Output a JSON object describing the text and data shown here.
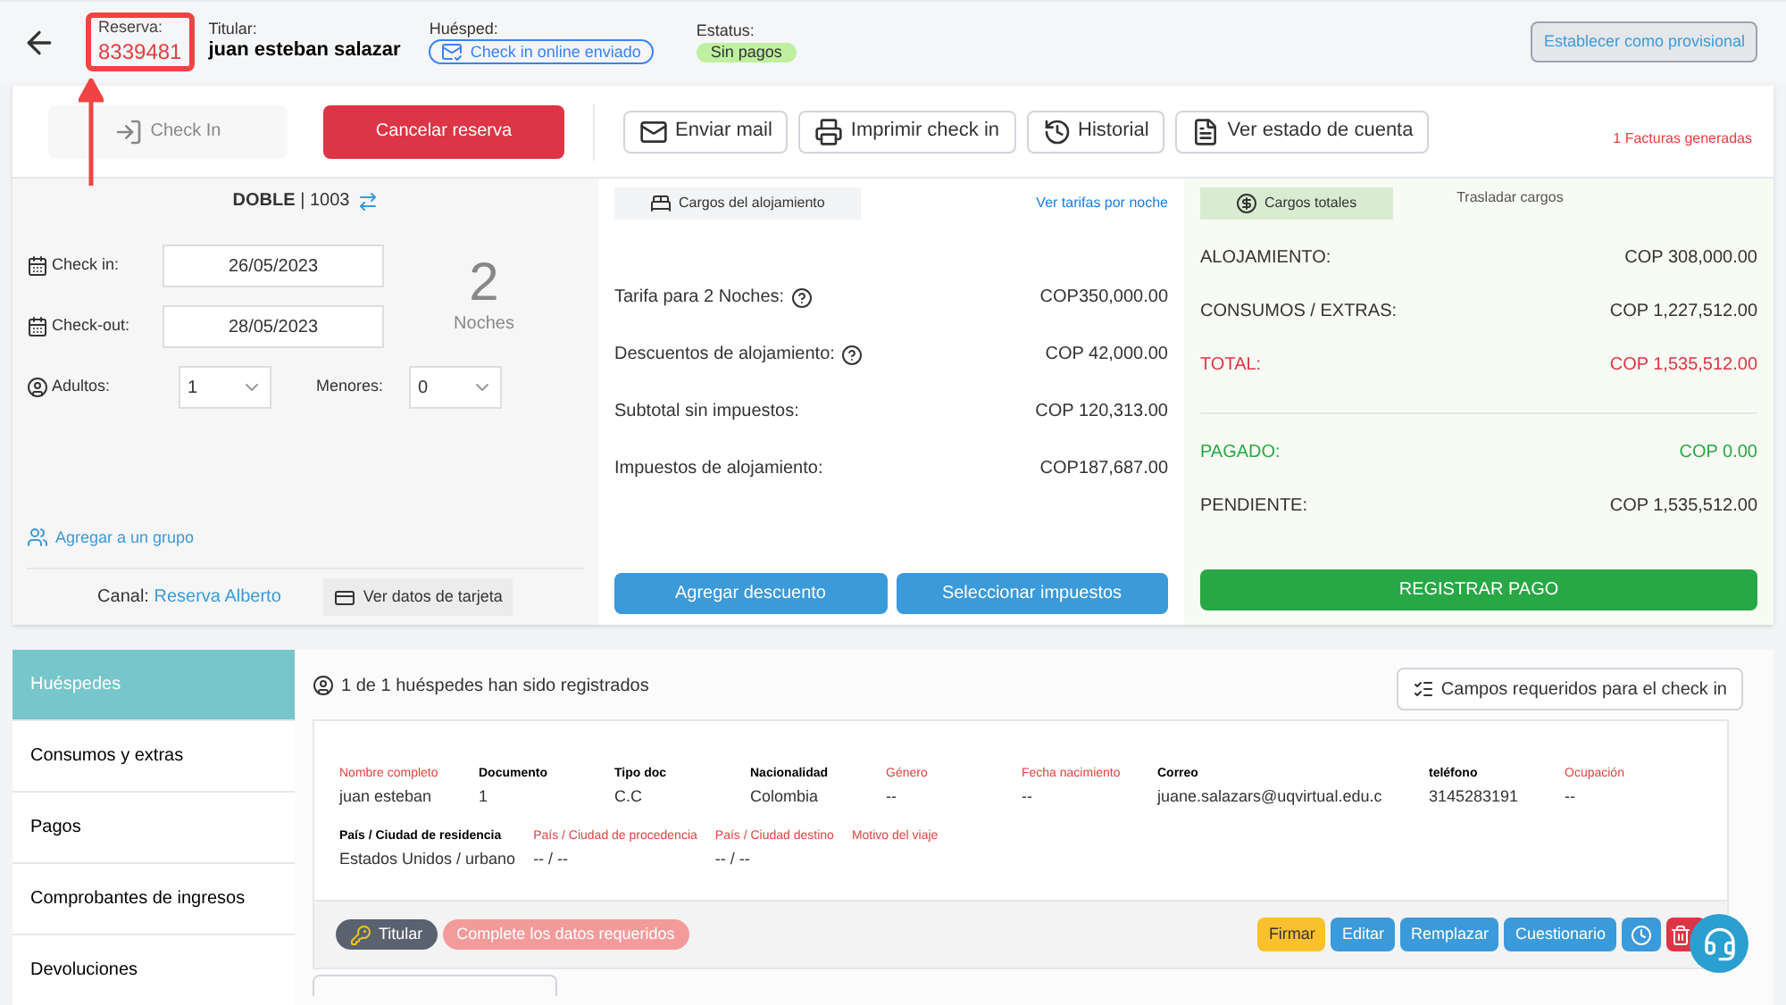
{
  "header": {
    "reservation": {
      "label": "Reserva:",
      "number": "8339481"
    },
    "holder": {
      "label": "Titular:",
      "name": "juan esteban salazar"
    },
    "guest": {
      "label": "Huésped:",
      "badge": "Check in online enviado"
    },
    "status": {
      "label": "Estatus:",
      "badge": "Sin pagos"
    },
    "provisional_button": "Establecer como provisional"
  },
  "actions": {
    "check_in": {
      "label": "Check In",
      "disabled": true
    },
    "cancel": "Cancelar reserva",
    "buttons": [
      {
        "label": "Enviar mail",
        "kind": "mail"
      },
      {
        "label": "Imprimir check in",
        "kind": "print"
      },
      {
        "label": "Historial",
        "kind": "history"
      },
      {
        "label": "Ver estado de cuenta",
        "kind": "statement"
      }
    ],
    "invoices": "1 Facturas generadas"
  },
  "room": {
    "type": "DOBLE",
    "separator": "|",
    "number": "1003",
    "check_in": {
      "label": "Check in:",
      "value": "26/05/2023"
    },
    "check_out": {
      "label": "Check-out:",
      "value": "28/05/2023"
    },
    "nights": {
      "count": "2",
      "label": "Noches"
    },
    "adults": {
      "label": "Adultos:",
      "value": "1"
    },
    "minors": {
      "label": "Menores:",
      "value": "0"
    },
    "group_link": "Agregar a un grupo",
    "channel": {
      "label": "Canal:",
      "value": "Reserva Alberto"
    },
    "card_button": "Ver datos de tarjeta"
  },
  "charges": {
    "tab": "Cargos del alojamiento",
    "rates_link": "Ver tarifas por noche",
    "rows": [
      {
        "label": "Tarifa para 2 Noches:",
        "help": true,
        "value": "COP350,000.00"
      },
      {
        "label": "Descuentos de alojamiento:",
        "help": true,
        "value": "COP 42,000.00"
      },
      {
        "label": "Subtotal sin impuestos:",
        "help": false,
        "value": "COP 120,313.00"
      },
      {
        "label": "Impuestos de alojamiento:",
        "help": false,
        "value": "COP187,687.00"
      }
    ],
    "buttons": [
      "Agregar descuento",
      "Seleccionar impuestos"
    ]
  },
  "totals": {
    "tabs": [
      {
        "label": "Cargos totales",
        "selected": true
      },
      {
        "label": "Trasladar cargos",
        "selected": false
      }
    ],
    "rows": [
      {
        "label": "ALOJAMIENTO:",
        "value": "COP 308,000.00",
        "kind": "normal"
      },
      {
        "label": "CONSUMOS / EXTRAS:",
        "value": "COP 1,227,512.00",
        "kind": "normal"
      },
      {
        "label": "TOTAL:",
        "value": "COP 1,535,512.00",
        "kind": "total"
      },
      {
        "label": "PAGADO:",
        "value": "COP 0.00",
        "kind": "paid"
      },
      {
        "label": "PENDIENTE:",
        "value": "COP 1,535,512.00",
        "kind": "normal"
      }
    ],
    "pay_button": "REGISTRAR PAGO"
  },
  "sidebar": [
    {
      "label": "Huéspedes",
      "selected": true
    },
    {
      "label": "Consumos y extras",
      "selected": false
    },
    {
      "label": "Pagos",
      "selected": false
    },
    {
      "label": "Comprobantes de ingresos",
      "selected": false
    },
    {
      "label": "Devoluciones",
      "selected": false
    }
  ],
  "guests": {
    "summary": "1 de 1 huéspedes han sido registrados",
    "required_button": "Campos requeridos para el check in",
    "fields_row1": [
      {
        "label": "Nombre completo",
        "value": "juan esteban",
        "required": true
      },
      {
        "label": "Documento",
        "value": "1",
        "required": false
      },
      {
        "label": "Tipo doc",
        "value": "C.C",
        "required": false
      },
      {
        "label": "Nacionalidad",
        "value": "Colombia",
        "required": false
      },
      {
        "label": "Género",
        "value": "--",
        "required": true
      },
      {
        "label": "Fecha nacimiento",
        "value": "--",
        "required": true
      },
      {
        "label": "Correo",
        "value": "juane.salazars@uqvirtual.edu.c",
        "required": false
      },
      {
        "label": "teléfono",
        "value": "3145283191",
        "required": false
      },
      {
        "label": "Ocupación",
        "value": "--",
        "required": true
      }
    ],
    "fields_row2": [
      {
        "label": "País / Ciudad de residencia",
        "value": "Estados Unidos / urbano",
        "required": false
      },
      {
        "label": "País / Ciudad de procedencia",
        "value": "-- / --",
        "required": true
      },
      {
        "label": "País / Ciudad destino",
        "value": "-- / --",
        "required": true
      },
      {
        "label": "Motivo del viaje",
        "required": true
      }
    ],
    "holder_badge": "Titular",
    "warning_badge": "Complete los datos requeridos",
    "buttons": [
      {
        "label": "Firmar",
        "kind": "sign"
      },
      {
        "label": "Editar",
        "kind": "primary"
      },
      {
        "label": "Remplazar",
        "kind": "primary"
      },
      {
        "label": "Cuestionario",
        "kind": "primary"
      },
      {
        "kind": "history"
      },
      {
        "kind": "delete"
      }
    ]
  }
}
